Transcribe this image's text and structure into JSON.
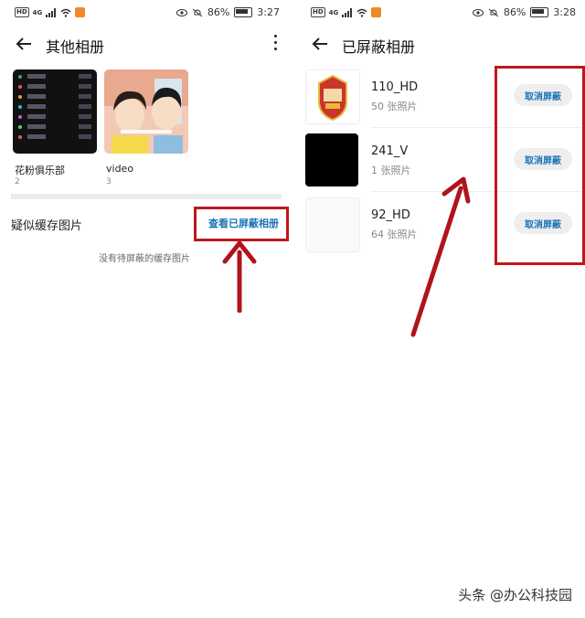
{
  "left": {
    "status": {
      "network": "HD",
      "signal": "4G",
      "battery": "86%",
      "time": "3:27"
    },
    "title": "其他相册",
    "albums": [
      {
        "name": "花粉俱乐部",
        "count": "2"
      },
      {
        "name": "video",
        "count": "3"
      }
    ],
    "section_title": "疑似缓存图片",
    "view_hidden_link": "查看已屏蔽相册",
    "empty_message": "没有待屏蔽的缓存图片"
  },
  "right": {
    "status": {
      "network": "HD",
      "signal": "4G",
      "battery": "86%",
      "time": "3:28"
    },
    "title": "已屏蔽相册",
    "albums": [
      {
        "name": "110_HD",
        "count": "50 张照片",
        "action": "取消屏蔽"
      },
      {
        "name": "241_V",
        "count": "1 张照片",
        "action": "取消屏蔽"
      },
      {
        "name": "92_HD",
        "count": "64 张照片",
        "action": "取消屏蔽"
      }
    ]
  },
  "watermark": "头条 @办公科技园",
  "colors": {
    "accent": "#1a73b5",
    "annotation": "#c0161c"
  },
  "icons": [
    "back-arrow-icon",
    "more-vert-icon",
    "wifi-icon",
    "eye-icon",
    "mute-icon",
    "battery-icon"
  ]
}
